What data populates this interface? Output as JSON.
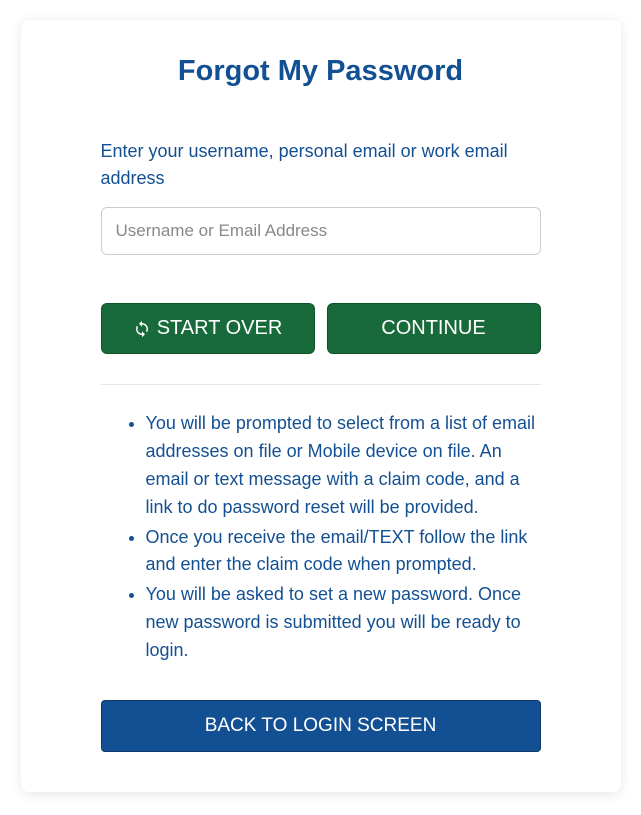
{
  "title": "Forgot My Password",
  "prompt": "Enter your username, personal email or work email address",
  "input": {
    "placeholder": "Username or Email Address",
    "value": ""
  },
  "buttons": {
    "start_over": "START OVER",
    "continue": "CONTINUE",
    "back": "BACK TO LOGIN SCREEN"
  },
  "instructions": [
    "You will be prompted to select from a list of email addresses on file or Mobile device on file. An email or text message with a claim code, and a link to do password reset will be provided.",
    "Once you receive the email/TEXT follow the link and enter the claim code when prompted.",
    "You will be asked to set a new password. Once new password is submitted you will be ready to login."
  ]
}
